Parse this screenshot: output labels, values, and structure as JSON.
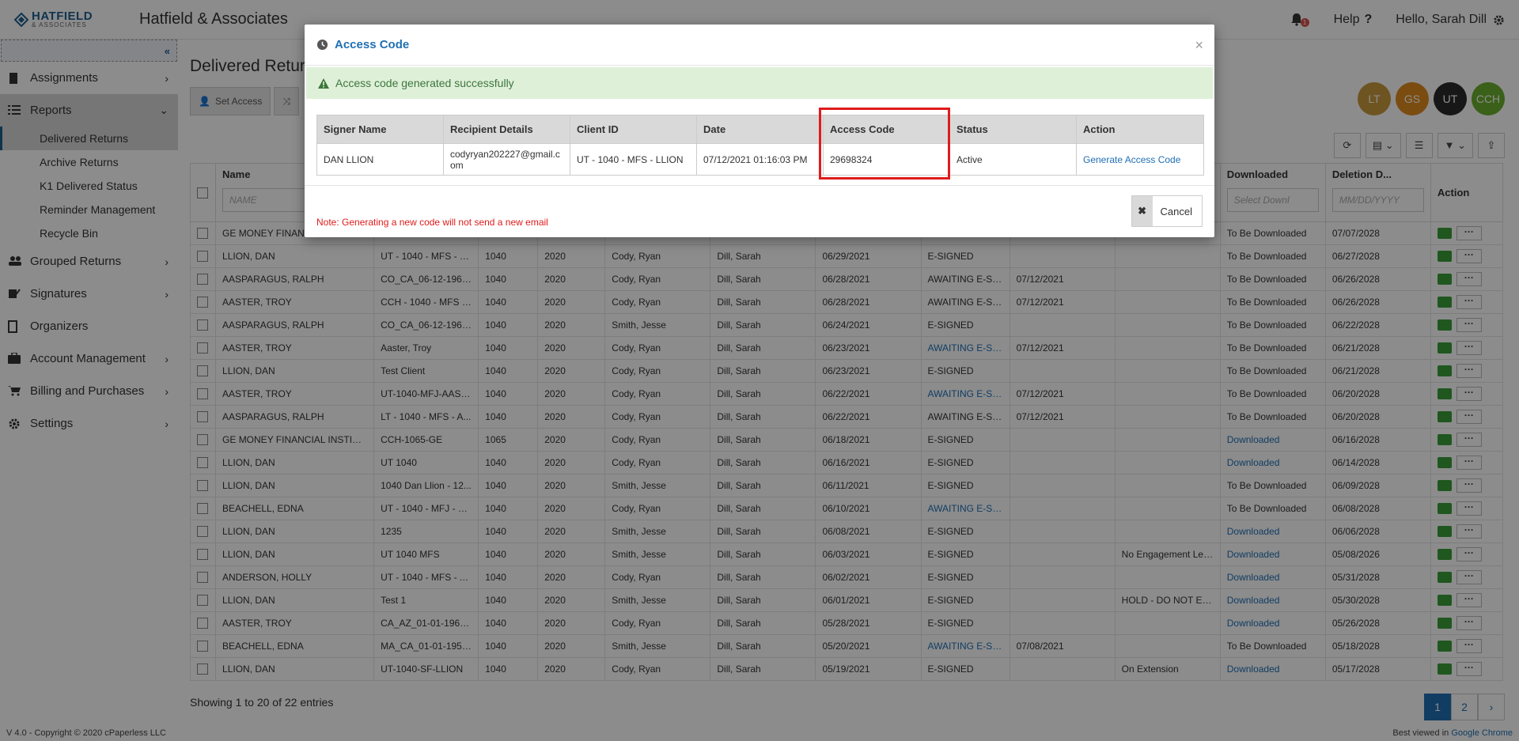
{
  "header": {
    "logo_main": "HATFIELD",
    "logo_sub": "& ASSOCIATES",
    "company": "Hatfield & Associates",
    "notification_count": "1",
    "help_label": "Help",
    "greeting": "Hello, Sarah Dill"
  },
  "sidebar": {
    "items": [
      {
        "label": "Assignments"
      },
      {
        "label": "Reports"
      },
      {
        "label": "Grouped Returns"
      },
      {
        "label": "Signatures"
      },
      {
        "label": "Organizers"
      },
      {
        "label": "Account Management"
      },
      {
        "label": "Billing and Purchases"
      },
      {
        "label": "Settings"
      }
    ],
    "reports_sub": [
      {
        "label": "Delivered Returns"
      },
      {
        "label": "Archive Returns"
      },
      {
        "label": "K1 Delivered Status"
      },
      {
        "label": "Reminder Management"
      },
      {
        "label": "Recycle Bin"
      }
    ]
  },
  "page": {
    "title": "Delivered Returns",
    "set_access_label": "Set Access",
    "avatars": [
      {
        "initials": "LT",
        "color": "#c89a3c"
      },
      {
        "initials": "GS",
        "color": "#e08a1e"
      },
      {
        "initials": "UT",
        "color": "#2b2b2b"
      },
      {
        "initials": "CCH",
        "color": "#6bb02e"
      }
    ]
  },
  "grid": {
    "headers": [
      "Name",
      "Downloaded",
      "Deletion D...",
      "Action"
    ],
    "name_placeholder": "NAME",
    "downloaded_placeholder": "Select Downl",
    "deletion_placeholder": "MM/DD/YYYY",
    "rows": [
      [
        "GE MONEY FINANCIAL INSTITUT...",
        "",
        "",
        "",
        "",
        "",
        "",
        "",
        "",
        "",
        "To Be Downloaded",
        "07/07/2028"
      ],
      [
        "LLION, DAN",
        "UT - 1040 - MFS - L...",
        "1040",
        "2020",
        "Cody, Ryan",
        "Dill, Sarah",
        "06/29/2021",
        "E-SIGNED",
        "",
        "",
        "To Be Downloaded",
        "06/27/2028"
      ],
      [
        "AASPARAGUS, RALPH",
        "CO_CA_06-12-1963...",
        "1040",
        "2020",
        "Cody, Ryan",
        "Dill, Sarah",
        "06/28/2021",
        "AWAITING E-SI...",
        "07/12/2021",
        "",
        "To Be Downloaded",
        "06/26/2028"
      ],
      [
        "AASTER, TROY",
        "CCH - 1040 - MFS - ...",
        "1040",
        "2020",
        "Cody, Ryan",
        "Dill, Sarah",
        "06/28/2021",
        "AWAITING E-SI...",
        "07/12/2021",
        "",
        "To Be Downloaded",
        "06/26/2028"
      ],
      [
        "AASPARAGUS, RALPH",
        "CO_CA_06-12-1963...",
        "1040",
        "2020",
        "Smith, Jesse",
        "Dill, Sarah",
        "06/24/2021",
        "E-SIGNED",
        "",
        "",
        "To Be Downloaded",
        "06/22/2028"
      ],
      [
        "AASTER, TROY",
        "Aaster, Troy",
        "1040",
        "2020",
        "Cody, Ryan",
        "Dill, Sarah",
        "06/23/2021",
        "AWAITING E-SI...",
        "07/12/2021",
        "",
        "To Be Downloaded",
        "06/21/2028"
      ],
      [
        "LLION, DAN",
        "Test Client",
        "1040",
        "2020",
        "Cody, Ryan",
        "Dill, Sarah",
        "06/23/2021",
        "E-SIGNED",
        "",
        "",
        "To Be Downloaded",
        "06/21/2028"
      ],
      [
        "AASTER, TROY",
        "UT-1040-MFJ-AAST...",
        "1040",
        "2020",
        "Cody, Ryan",
        "Dill, Sarah",
        "06/22/2021",
        "AWAITING E-SI...",
        "07/12/2021",
        "",
        "To Be Downloaded",
        "06/20/2028"
      ],
      [
        "AASPARAGUS, RALPH",
        "LT - 1040 - MFS - A...",
        "1040",
        "2020",
        "Cody, Ryan",
        "Dill, Sarah",
        "06/22/2021",
        "AWAITING E-SI...",
        "07/12/2021",
        "",
        "To Be Downloaded",
        "06/20/2028"
      ],
      [
        "GE MONEY FINANCIAL INSTITUT...",
        "CCH-1065-GE",
        "1065",
        "2020",
        "Cody, Ryan",
        "Dill, Sarah",
        "06/18/2021",
        "E-SIGNED",
        "",
        "",
        "Downloaded",
        "06/16/2028"
      ],
      [
        "LLION, DAN",
        "UT 1040",
        "1040",
        "2020",
        "Cody, Ryan",
        "Dill, Sarah",
        "06/16/2021",
        "E-SIGNED",
        "",
        "",
        "Downloaded",
        "06/14/2028"
      ],
      [
        "LLION, DAN",
        "1040 Dan Llion - 12...",
        "1040",
        "2020",
        "Smith, Jesse",
        "Dill, Sarah",
        "06/11/2021",
        "E-SIGNED",
        "",
        "",
        "To Be Downloaded",
        "06/09/2028"
      ],
      [
        "BEACHELL, EDNA",
        "UT - 1040 - MFJ - E...",
        "1040",
        "2020",
        "Cody, Ryan",
        "Dill, Sarah",
        "06/10/2021",
        "AWAITING E-SI...",
        "",
        "",
        "To Be Downloaded",
        "06/08/2028"
      ],
      [
        "LLION, DAN",
        "1235",
        "1040",
        "2020",
        "Smith, Jesse",
        "Dill, Sarah",
        "06/08/2021",
        "E-SIGNED",
        "",
        "",
        "Downloaded",
        "06/06/2028"
      ],
      [
        "LLION, DAN",
        "UT 1040 MFS",
        "1040",
        "2020",
        "Smith, Jesse",
        "Dill, Sarah",
        "06/03/2021",
        "E-SIGNED",
        "",
        "No Engagement Let...",
        "Downloaded",
        "05/08/2026"
      ],
      [
        "ANDERSON, HOLLY",
        "UT - 1040 - MFS - A...",
        "1040",
        "2020",
        "Cody, Ryan",
        "Dill, Sarah",
        "06/02/2021",
        "E-SIGNED",
        "",
        "",
        "Downloaded",
        "05/31/2028"
      ],
      [
        "LLION, DAN",
        "Test 1",
        "1040",
        "2020",
        "Smith, Jesse",
        "Dill, Sarah",
        "06/01/2021",
        "E-SIGNED",
        "",
        "HOLD - DO NOT EFI...",
        "Downloaded",
        "05/30/2028"
      ],
      [
        "AASTER, TROY",
        "CA_AZ_01-01-1960_...",
        "1040",
        "2020",
        "Cody, Ryan",
        "Dill, Sarah",
        "05/28/2021",
        "E-SIGNED",
        "",
        "",
        "Downloaded",
        "05/26/2028"
      ],
      [
        "BEACHELL, EDNA",
        "MA_CA_01-01-1955...",
        "1040",
        "2020",
        "Smith, Jesse",
        "Dill, Sarah",
        "05/20/2021",
        "AWAITING E-SI...",
        "07/08/2021",
        "",
        "To Be Downloaded",
        "05/18/2028"
      ],
      [
        "LLION, DAN",
        "UT-1040-SF-LLION",
        "1040",
        "2020",
        "Cody, Ryan",
        "Dill, Sarah",
        "05/19/2021",
        "E-SIGNED",
        "",
        "On Extension",
        "Downloaded",
        "05/17/2028"
      ]
    ],
    "showing": "Showing 1 to 20 of 22 entries",
    "pages": [
      "1",
      "2"
    ]
  },
  "modal": {
    "title": "Access Code",
    "alert": "Access code generated successfully",
    "headers": [
      "Signer Name",
      "Recipient Details",
      "Client ID",
      "Date",
      "Access Code",
      "Status",
      "Action"
    ],
    "row": {
      "signer": "DAN LLION",
      "recipient": "codyryan202227@gmail.com",
      "client_id": "UT - 1040 - MFS - LLION",
      "date": "07/12/2021 01:16:03 PM",
      "code": "29698324",
      "status": "Active",
      "action": "Generate Access Code"
    },
    "note": "Note: Generating a new code will not send a new email",
    "cancel_label": "Cancel"
  },
  "footer": {
    "left": "V 4.0 - Copyright © 2020 cPaperless LLC",
    "right_prefix": "Best viewed in ",
    "right_link": "Google Chrome"
  }
}
